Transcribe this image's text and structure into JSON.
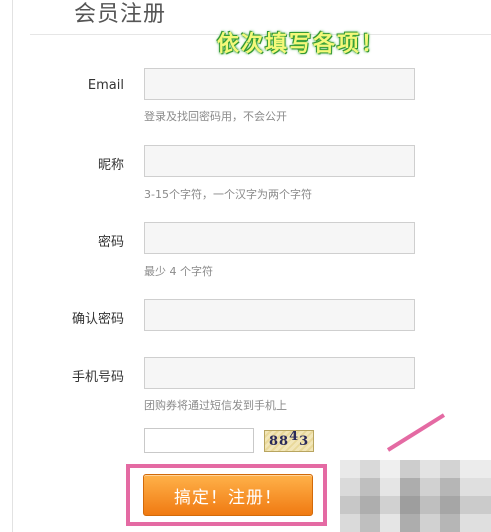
{
  "header": {
    "title": "会员注册",
    "annotation": "依次填写各项！"
  },
  "form": {
    "fields": [
      {
        "label": "Email",
        "value": "",
        "hint": "登录及找回密码用，不会公开"
      },
      {
        "label": "昵称",
        "value": "",
        "hint": "3-15个字符，一个汉字为两个字符"
      },
      {
        "label": "密码",
        "value": "",
        "hint": "最少 4 个字符"
      },
      {
        "label": "确认密码",
        "value": "",
        "hint": ""
      },
      {
        "label": "手机号码",
        "value": "",
        "hint": "团购券将通过短信发到手机上"
      }
    ],
    "captcha": {
      "value": "",
      "code_chars": [
        "8",
        "8",
        "4",
        "3"
      ]
    },
    "submit_label": "搞定！注册！"
  },
  "colors": {
    "highlight": "#e46aa3",
    "button": "#f07a12"
  }
}
